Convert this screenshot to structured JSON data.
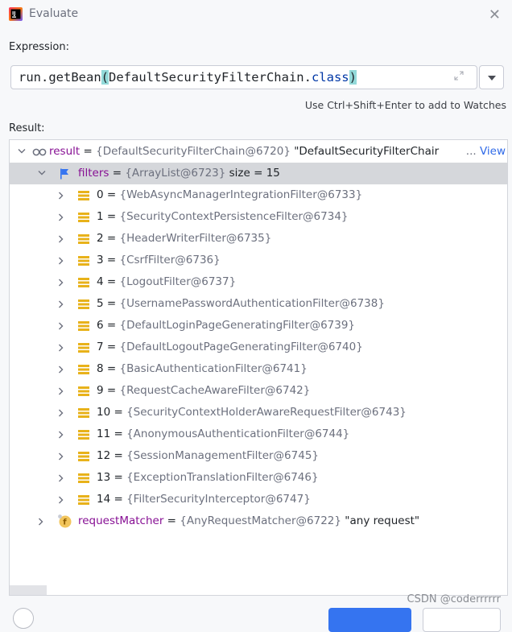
{
  "window": {
    "title": "Evaluate"
  },
  "expression": {
    "label": "Expression:",
    "prefix": "run.getBean",
    "open_paren": "(",
    "middle": "DefaultSecurityFilterChain.",
    "keyword": "class",
    "close_paren": ")"
  },
  "hint": "Use Ctrl+Shift+Enter to add to Watches",
  "result": {
    "label": "Result:",
    "root": {
      "name": "result",
      "eq": " = ",
      "ref": "{DefaultSecurityFilterChain@6720}",
      "value": " \"DefaultSecurityFilterChair",
      "ellipsis": "...",
      "view": "View"
    },
    "filters": {
      "name": "filters",
      "eq": " = ",
      "ref": "{ArrayList@6723}",
      "size": "  size = 15"
    },
    "items": [
      {
        "index": "0",
        "ref": "{WebAsyncManagerIntegrationFilter@6733}"
      },
      {
        "index": "1",
        "ref": "{SecurityContextPersistenceFilter@6734}"
      },
      {
        "index": "2",
        "ref": "{HeaderWriterFilter@6735}"
      },
      {
        "index": "3",
        "ref": "{CsrfFilter@6736}"
      },
      {
        "index": "4",
        "ref": "{LogoutFilter@6737}"
      },
      {
        "index": "5",
        "ref": "{UsernamePasswordAuthenticationFilter@6738}"
      },
      {
        "index": "6",
        "ref": "{DefaultLoginPageGeneratingFilter@6739}"
      },
      {
        "index": "7",
        "ref": "{DefaultLogoutPageGeneratingFilter@6740}"
      },
      {
        "index": "8",
        "ref": "{BasicAuthenticationFilter@6741}"
      },
      {
        "index": "9",
        "ref": "{RequestCacheAwareFilter@6742}"
      },
      {
        "index": "10",
        "ref": "{SecurityContextHolderAwareRequestFilter@6743}"
      },
      {
        "index": "11",
        "ref": "{AnonymousAuthenticationFilter@6744}"
      },
      {
        "index": "12",
        "ref": "{SessionManagementFilter@6745}"
      },
      {
        "index": "13",
        "ref": "{ExceptionTranslationFilter@6746}"
      },
      {
        "index": "14",
        "ref": "{FilterSecurityInterceptor@6747}"
      }
    ],
    "matcher": {
      "name": "requestMatcher",
      "eq": " = ",
      "ref": "{AnyRequestMatcher@6722}",
      "value": " \"any request\""
    }
  },
  "watermark": "CSDN @coderrrrrr",
  "colors": {
    "accent": "#3574f0",
    "highlight": "#93d9d9",
    "selected_row": "#d5d7db",
    "variable": "#871094",
    "reference": "#6c707e",
    "link": "#2f6ae8",
    "list_icon": "#e8b21a"
  },
  "icons": {
    "app": "intellij-logo-icon",
    "close": "close-icon",
    "expand": "expand-icon",
    "dropdown": "chevron-down-icon",
    "expanded_node": "chevron-down-icon",
    "collapsed_node": "chevron-right-icon",
    "root": "watch-glasses-icon",
    "filters": "flag-icon",
    "item": "list-item-icon",
    "field": "field-icon"
  }
}
